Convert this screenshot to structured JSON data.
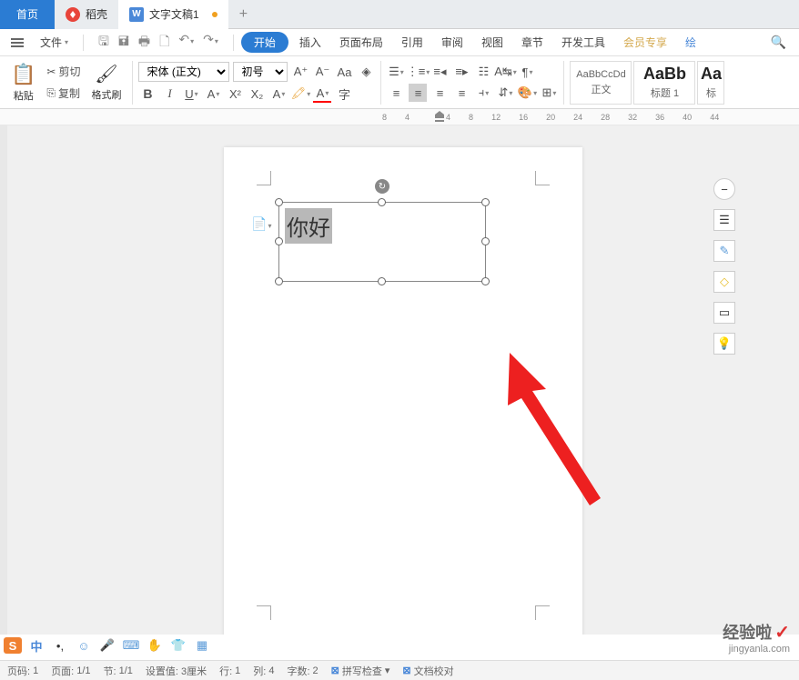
{
  "tabs": {
    "home": "首页",
    "shell": "稻壳",
    "doc": "文字文稿1"
  },
  "menu": {
    "file": "文件",
    "start": "开始",
    "insert": "插入",
    "layout": "页面布局",
    "ref": "引用",
    "review": "审阅",
    "view": "视图",
    "chapter": "章节",
    "dev": "开发工具",
    "vip": "会员专享",
    "draw": "绘"
  },
  "ribbon": {
    "paste": "粘贴",
    "cut": "剪切",
    "copy": "复制",
    "format_painter": "格式刷",
    "font_name": "宋体 (正文)",
    "font_size": "初号",
    "style_normal_preview": "AaBbCcDd",
    "style_normal": "正文",
    "style_h1_preview": "AaBb",
    "style_h1": "标题 1",
    "style_h2_preview": "Aa",
    "style_h2": "标"
  },
  "ruler": [
    "8",
    "4",
    "",
    "4",
    "8",
    "12",
    "16",
    "20",
    "24",
    "28",
    "32",
    "36",
    "40",
    "44"
  ],
  "textbox": {
    "content": "你好"
  },
  "lang": {
    "cn": "中"
  },
  "watermark": {
    "brand": "经验啦",
    "site": "jingyanla.com"
  },
  "status": {
    "page_no_label": "页码:",
    "page_no": "1",
    "page_label": "页面:",
    "page": "1/1",
    "section_label": "节:",
    "section": "1/1",
    "setval_label": "设置值:",
    "setval": "3厘米",
    "row_label": "行:",
    "row": "1",
    "col_label": "列:",
    "col": "4",
    "wc_label": "字数:",
    "wc": "2",
    "spell": "拼写检查",
    "proof": "文档校对"
  }
}
